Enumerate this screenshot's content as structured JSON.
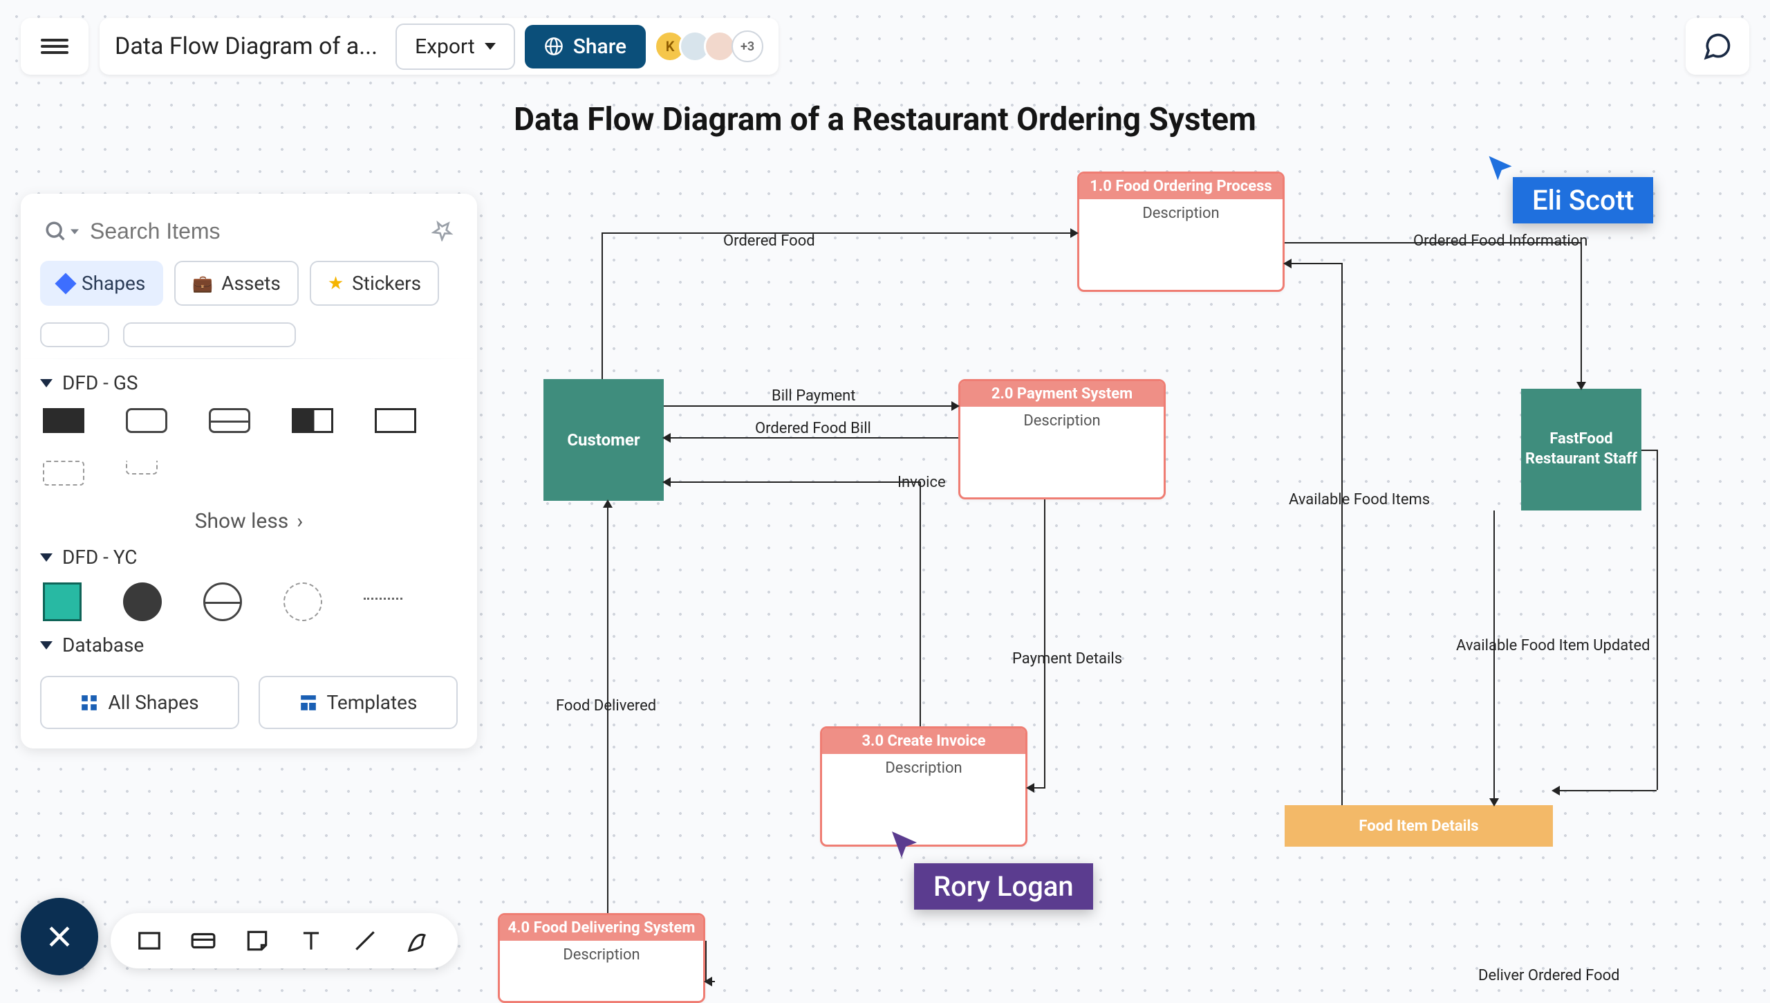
{
  "header": {
    "doc_title": "Data Flow Diagram of a...",
    "export_label": "Export",
    "share_label": "Share",
    "avatar_initial": "K",
    "avatar_more": "+3"
  },
  "search": {
    "placeholder": "Search Items"
  },
  "tabs": {
    "shapes": "Shapes",
    "assets": "Assets",
    "stickers": "Stickers"
  },
  "sections": {
    "dfd_gs": "DFD - GS",
    "dfd_yc": "DFD - YC",
    "database": "Database",
    "show_less": "Show less"
  },
  "panel_buttons": {
    "all_shapes": "All Shapes",
    "templates": "Templates"
  },
  "canvas": {
    "title": "Data Flow Diagram of a Restaurant Ordering System",
    "nodes": {
      "customer": "Customer",
      "staff": "FastFood Restaurant Staff",
      "p1_title": "1.0  Food Ordering Process",
      "p1_desc": "Description",
      "p2_title": "2.0 Payment System",
      "p2_desc": "Description",
      "p3_title": "3.0 Create Invoice",
      "p3_desc": "Description",
      "p4_title": "4.0 Food Delivering System",
      "p4_desc": "Description",
      "ds_food": "Food Item Details"
    },
    "edges": {
      "ordered_food": "Ordered Food",
      "bill_payment": "Bill Payment",
      "ordered_food_bill": "Ordered Food Bill",
      "invoice": "Invoice",
      "payment_details": "Payment Details",
      "food_delivered": "Food Delivered",
      "ordered_food_info": "Ordered Food Information",
      "available_food_items": "Available Food Items",
      "available_food_item_updated": "Available Food Item Updated",
      "deliver_ordered_food": "Deliver Ordered Food"
    },
    "cursors": {
      "eli": "Eli Scott",
      "rory": "Rory Logan"
    }
  }
}
